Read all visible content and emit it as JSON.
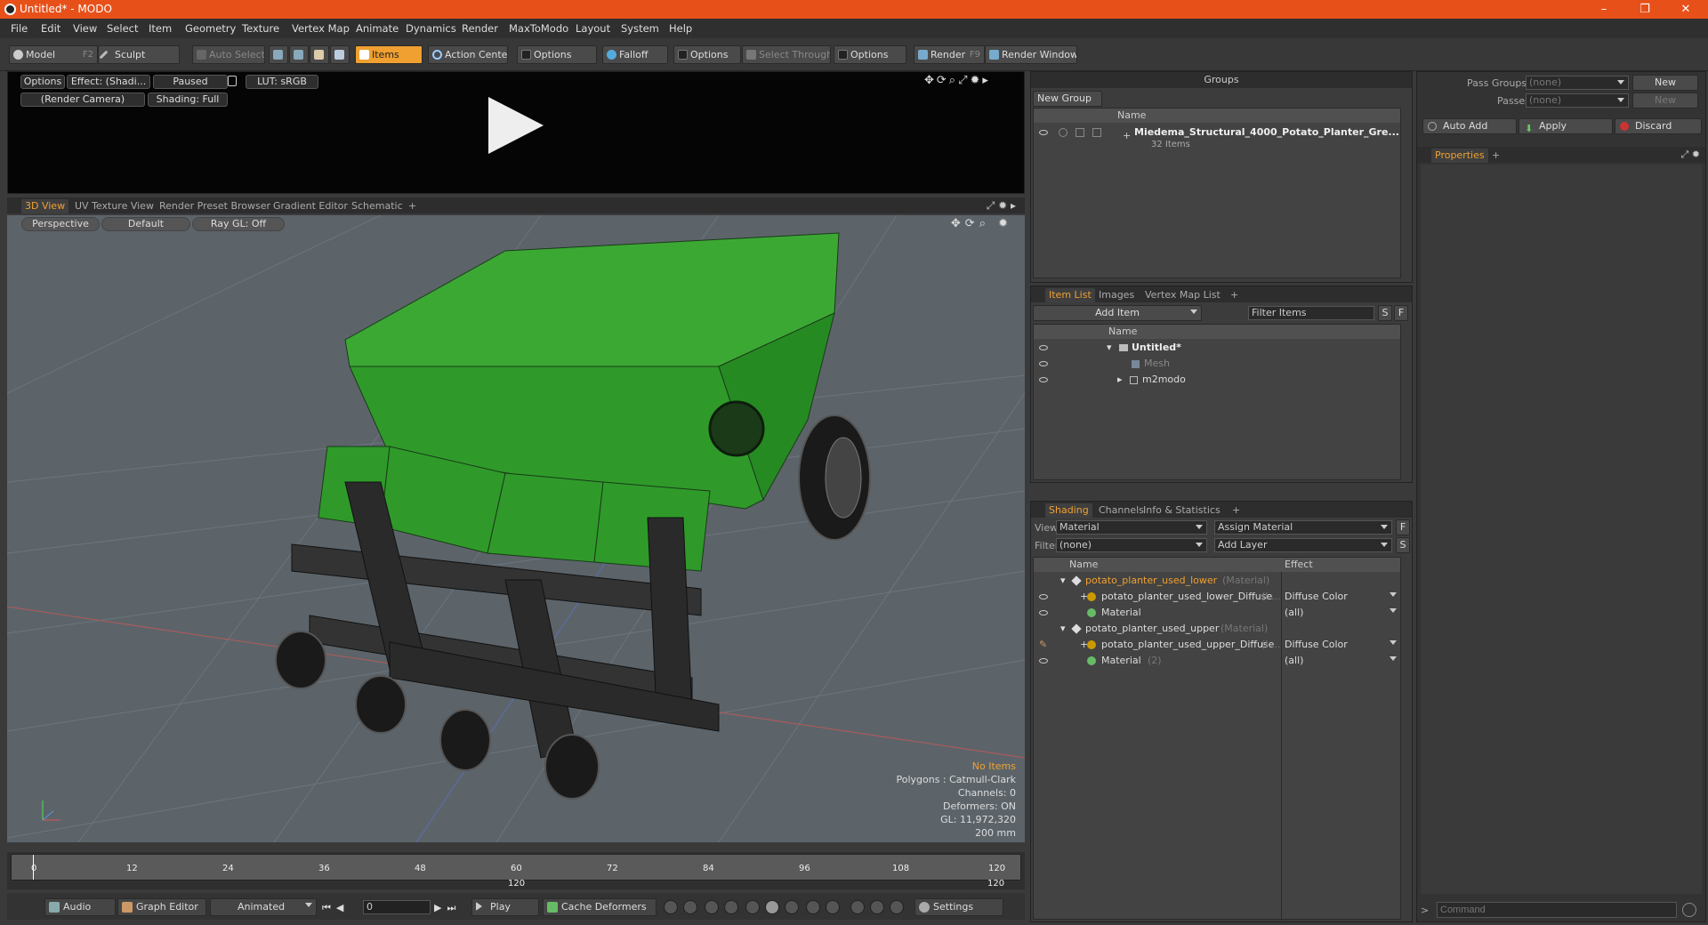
{
  "window": {
    "title": "Untitled* - MODO"
  },
  "menu": [
    "File",
    "Edit",
    "View",
    "Select",
    "Item",
    "Geometry",
    "Texture",
    "Vertex Map",
    "Animate",
    "Dynamics",
    "Render",
    "MaxToModo",
    "Layout",
    "System",
    "Help"
  ],
  "toolbar": {
    "model": "Model",
    "model_key": "F2",
    "sculpt": "Sculpt",
    "auto_select": "Auto Select",
    "items": "Items",
    "action_center": "Action Center",
    "options1": "Options",
    "falloff": "Falloff",
    "options2": "Options",
    "select_through": "Select Through",
    "options3": "Options",
    "render": "Render",
    "render_key": "F9",
    "render_window": "Render Window"
  },
  "preview": {
    "options": "Options",
    "effect": "Effect: (Shadi...",
    "paused": "Paused",
    "lut": "LUT: sRGB",
    "camera": "(Render Camera)",
    "shading": "Shading: Full"
  },
  "viewport_tabs": [
    "3D View",
    "UV Texture View",
    "Render Preset Browser",
    "Gradient Editor",
    "Schematic"
  ],
  "viewport": {
    "perspective": "Perspective",
    "default": "Default",
    "raygl": "Ray GL: Off",
    "hud": {
      "items": "No Items",
      "polygons": "Polygons : Catmull-Clark",
      "channels": "Channels: 0",
      "deformers": "Deformers: ON",
      "gl": "GL: 11,972,320",
      "scale": "200 mm"
    }
  },
  "timeline": {
    "ticks": [
      "0",
      "12",
      "24",
      "36",
      "48",
      "60",
      "72",
      "84",
      "96",
      "108",
      "120"
    ],
    "end_left": "120",
    "end_right": "120"
  },
  "bottombar": {
    "audio": "Audio",
    "graph_editor": "Graph Editor",
    "animated": "Animated",
    "frame": "0",
    "play": "Play",
    "cache_deformers": "Cache Deformers",
    "settings": "Settings"
  },
  "groups": {
    "title": "Groups",
    "new_group": "New Group",
    "col_name": "Name",
    "item_name": "Miedema_Structural_4000_Potato_Planter_Gre...",
    "item_count": "32 Items"
  },
  "item_list": {
    "tabs": [
      "Item List",
      "Images",
      "Vertex Map List"
    ],
    "add_item": "Add Item",
    "filter": "Filter Items",
    "col_name": "Name",
    "rows": [
      "Untitled*",
      "Mesh",
      "m2modo"
    ]
  },
  "shading": {
    "tabs": [
      "Shading",
      "Channels",
      "Info & Statistics"
    ],
    "view_label": "View",
    "view_value": "Material",
    "assign": "Assign Material",
    "filter_label": "Filter",
    "filter_value": "(none)",
    "add_layer": "Add Layer",
    "col_name": "Name",
    "col_effect": "Effect",
    "rows": [
      {
        "name": "potato_planter_used_lower",
        "tag": "(Material)",
        "effect": ""
      },
      {
        "name": "potato_planter_used_lower_Diffuse",
        "tag": "(I ...",
        "effect": "Diffuse Color"
      },
      {
        "name": "Material",
        "tag": "",
        "effect": "(all)"
      },
      {
        "name": "potato_planter_used_upper",
        "tag": "(Material)",
        "effect": ""
      },
      {
        "name": "potato_planter_used_upper_Diffuse",
        "tag": "(I ...",
        "effect": "Diffuse Color"
      },
      {
        "name": "Material",
        "tag": "(2)",
        "effect": "(all)"
      }
    ]
  },
  "props": {
    "pass_groups": "Pass Groups",
    "pass_groups_value": "(none)",
    "new1": "New",
    "passes": "Passes",
    "passes_value": "(none)",
    "new2": "New",
    "auto_add": "Auto Add",
    "apply": "Apply",
    "discard": "Discard",
    "properties_tab": "Properties",
    "command_placeholder": "Command"
  },
  "colors": {
    "accent": "#f0a030",
    "titlebar": "#e8501a",
    "model_green": "#2f9a2a"
  }
}
